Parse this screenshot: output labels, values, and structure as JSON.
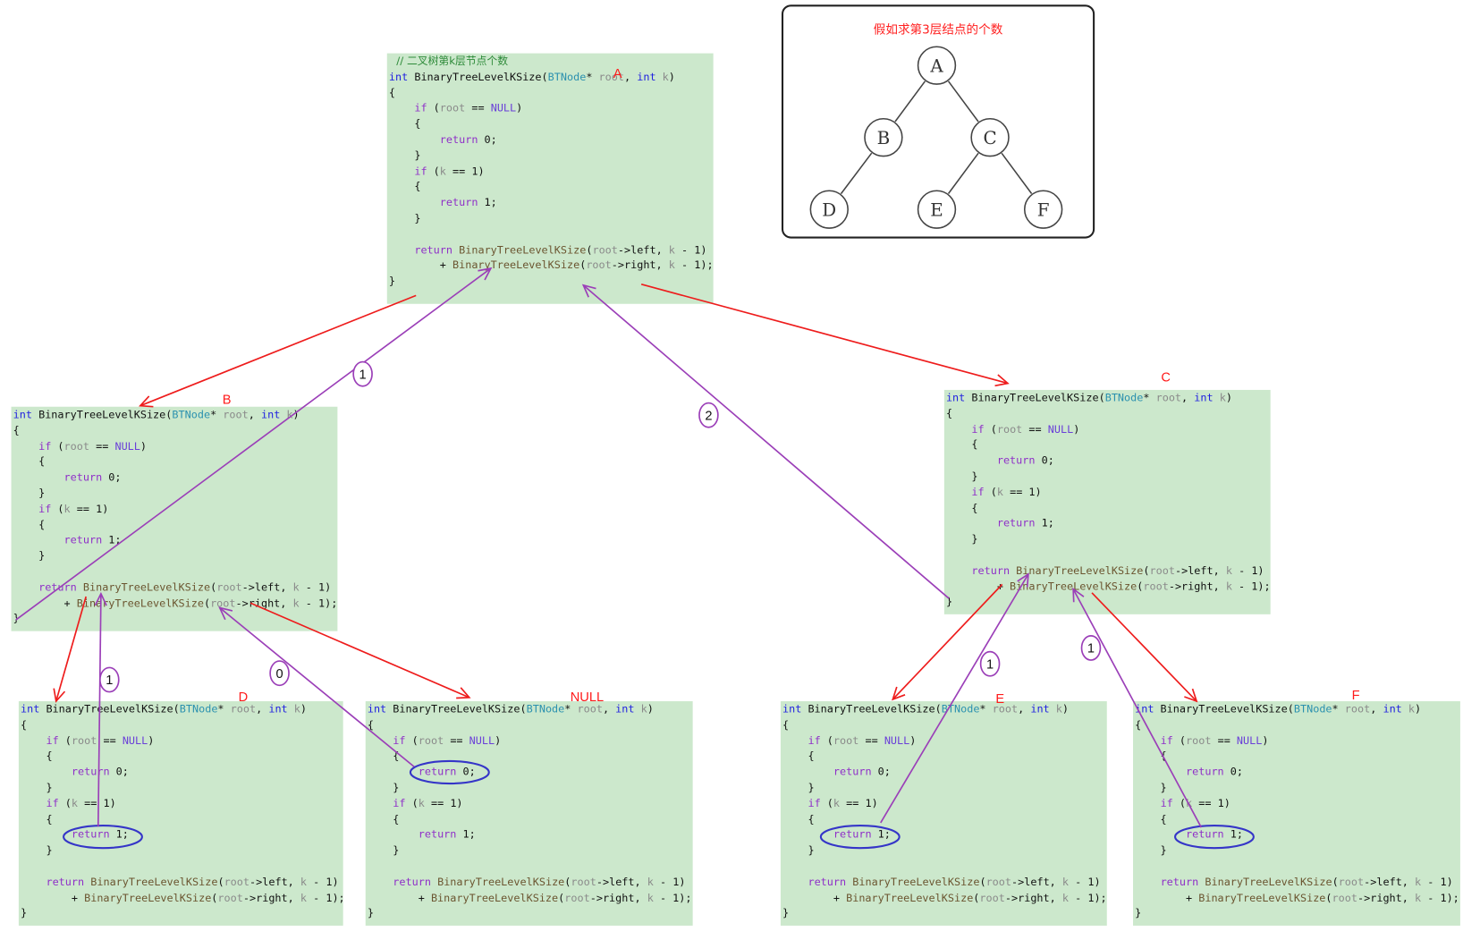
{
  "tree": {
    "title": "假如求第3层结点的个数",
    "nodes": [
      "A",
      "B",
      "C",
      "D",
      "E",
      "F"
    ],
    "edges": [
      [
        "A",
        "B"
      ],
      [
        "A",
        "C"
      ],
      [
        "B",
        "D"
      ],
      [
        "C",
        "E"
      ],
      [
        "C",
        "F"
      ]
    ]
  },
  "code": {
    "comment": "// 二叉树第k层节点个数",
    "lines": [
      [
        [
          "int",
          "type"
        ],
        [
          " BinaryTreeLevelKSize(",
          ""
        ],
        [
          "BTNode",
          "cls"
        ],
        [
          "* ",
          ""
        ],
        [
          "root",
          "param"
        ],
        [
          ", ",
          ""
        ],
        [
          "int",
          "type"
        ],
        [
          " ",
          ""
        ],
        [
          "k",
          "param"
        ],
        [
          ")",
          ""
        ]
      ],
      [
        [
          "{",
          ""
        ]
      ],
      [
        [
          "    ",
          ""
        ],
        [
          "if",
          "kw"
        ],
        [
          " (",
          ""
        ],
        [
          "root",
          "param"
        ],
        [
          " == ",
          ""
        ],
        [
          "NULL",
          "null"
        ],
        [
          ")",
          ""
        ]
      ],
      [
        [
          "    {",
          ""
        ]
      ],
      [
        [
          "        ",
          ""
        ],
        [
          "return",
          "kw"
        ],
        [
          " 0;",
          ""
        ]
      ],
      [
        [
          "    }",
          ""
        ]
      ],
      [
        [
          "    ",
          ""
        ],
        [
          "if",
          "kw"
        ],
        [
          " (",
          ""
        ],
        [
          "k",
          "param"
        ],
        [
          " == 1)",
          ""
        ]
      ],
      [
        [
          "    {",
          ""
        ]
      ],
      [
        [
          "        ",
          ""
        ],
        [
          "return",
          "kw"
        ],
        [
          " 1;",
          ""
        ]
      ],
      [
        [
          "    }",
          ""
        ]
      ],
      [
        [
          "",
          ""
        ]
      ],
      [
        [
          "    ",
          ""
        ],
        [
          "return",
          "kw"
        ],
        [
          " ",
          ""
        ],
        [
          "BinaryTreeLevelKSize",
          "fn"
        ],
        [
          "(",
          ""
        ],
        [
          "root",
          "param"
        ],
        [
          "->left, ",
          ""
        ],
        [
          "k",
          "param"
        ],
        [
          " - 1)",
          ""
        ]
      ],
      [
        [
          "        + ",
          ""
        ],
        [
          "BinaryTreeLevelKSize",
          "fn"
        ],
        [
          "(",
          ""
        ],
        [
          "root",
          "param"
        ],
        [
          "->right, ",
          ""
        ],
        [
          "k",
          "param"
        ],
        [
          " - 1);",
          ""
        ]
      ],
      [
        [
          "}",
          ""
        ]
      ]
    ]
  },
  "blocks": [
    {
      "id": "A",
      "label": "A"
    },
    {
      "id": "B",
      "label": "B"
    },
    {
      "id": "C",
      "label": "C"
    },
    {
      "id": "D",
      "label": "D"
    },
    {
      "id": "NULL",
      "label": "NULL"
    },
    {
      "id": "E",
      "label": "E"
    },
    {
      "id": "F",
      "label": "F"
    }
  ],
  "step_markers": [
    "1",
    "2",
    "1",
    "0",
    "1",
    "1"
  ],
  "colors": {
    "call_arrow": "#ee1c1c",
    "return_arrow": "#9b3fb8",
    "highlight": "#3535c8",
    "code_bg": "#cce8cc",
    "label": "#ff1a1a"
  }
}
